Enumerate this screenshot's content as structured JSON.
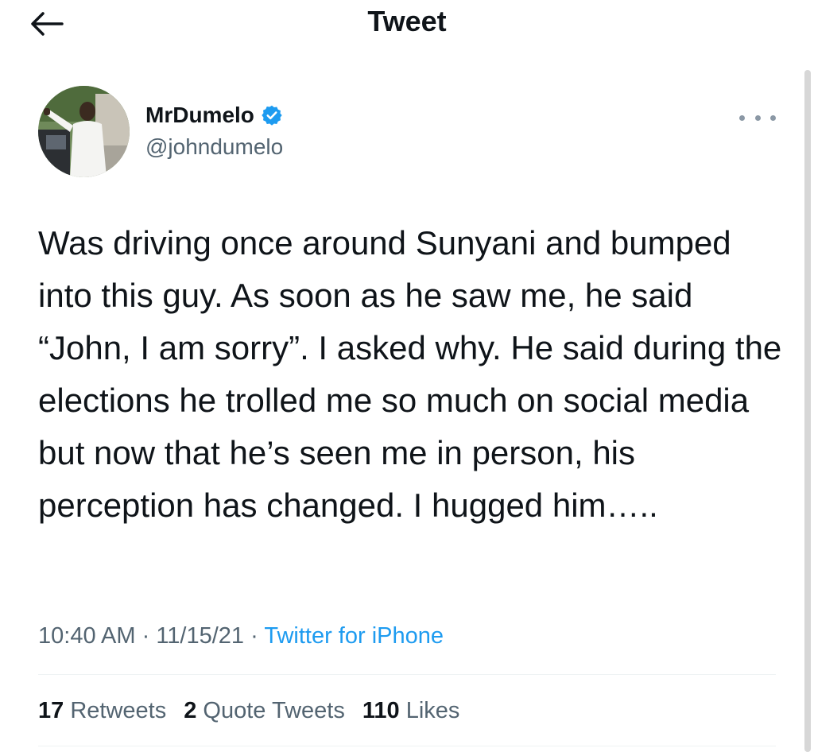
{
  "header": {
    "title": "Tweet",
    "back_icon": "arrow-left-icon"
  },
  "author": {
    "display_name": "MrDumelo",
    "handle": "@johndumelo",
    "verified": true,
    "verified_color": "#1d9bf0"
  },
  "tweet": {
    "text": "Was driving once around Sunyani and bumped into this guy. As soon as he saw me, he said “John, I am sorry”. I asked why. He said during the elections he trolled me so much on social media but now that he’s seen me in person, his perception has changed. I hugged him…..",
    "time": "10:40 AM",
    "date": "11/15/21",
    "separator": "·",
    "source": "Twitter for iPhone"
  },
  "stats": {
    "retweets_count": "17",
    "retweets_label": "Retweets",
    "quotes_count": "2",
    "quotes_label": "Quote Tweets",
    "likes_count": "110",
    "likes_label": "Likes"
  },
  "colors": {
    "accent": "#1d9bf0",
    "muted": "#536471",
    "text": "#0f1419"
  }
}
